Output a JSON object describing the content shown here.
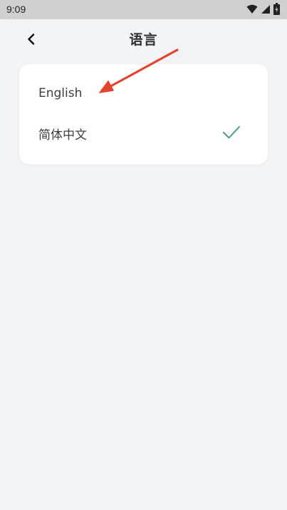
{
  "status_bar": {
    "time": "9:09"
  },
  "header": {
    "title": "语言"
  },
  "languages": [
    {
      "label": "English",
      "selected": false
    },
    {
      "label": "简体中文",
      "selected": true
    }
  ],
  "colors": {
    "accent_check": "#4a9a86",
    "annotation_arrow": "#e5432e"
  },
  "icons": {
    "back": "chevron-left-icon",
    "check": "check-icon",
    "wifi": "wifi-icon",
    "signal": "signal-icon",
    "battery": "battery-icon"
  }
}
